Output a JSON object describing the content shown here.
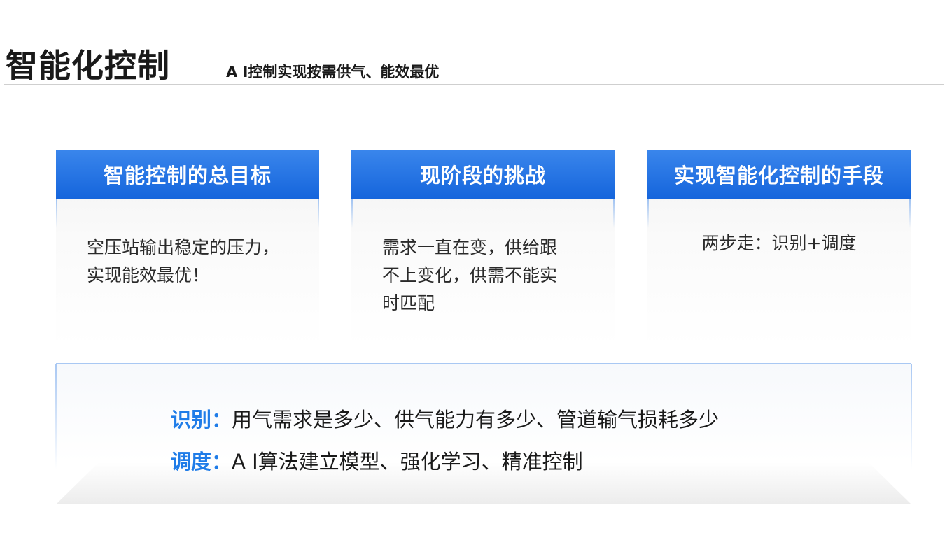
{
  "header": {
    "title": "智能化控制",
    "subtitle": "A I控制实现按需供气、能效最优"
  },
  "cards": [
    {
      "title": "智能控制的总目标",
      "lines": [
        "空压站输出稳定的压力，",
        "实现能效最优！"
      ]
    },
    {
      "title": "现阶段的挑战",
      "lines": [
        "需求一直在变，供给跟",
        "不上变化，供需不能实",
        "时匹配"
      ]
    },
    {
      "title": "实现智能化控制的手段",
      "lines": [
        "两步走：识别+调度"
      ]
    }
  ],
  "summary": {
    "identify_key": "识别：",
    "identify_text": "用气需求是多少、供气能力有多少、管道输气损耗多少",
    "dispatch_key": "调度：",
    "dispatch_text": "A I算法建立模型、强化学习、精准控制"
  },
  "colors": {
    "header_blue": "#1565dc",
    "key_blue": "#1f7ce8",
    "text": "#1a1a1a"
  }
}
